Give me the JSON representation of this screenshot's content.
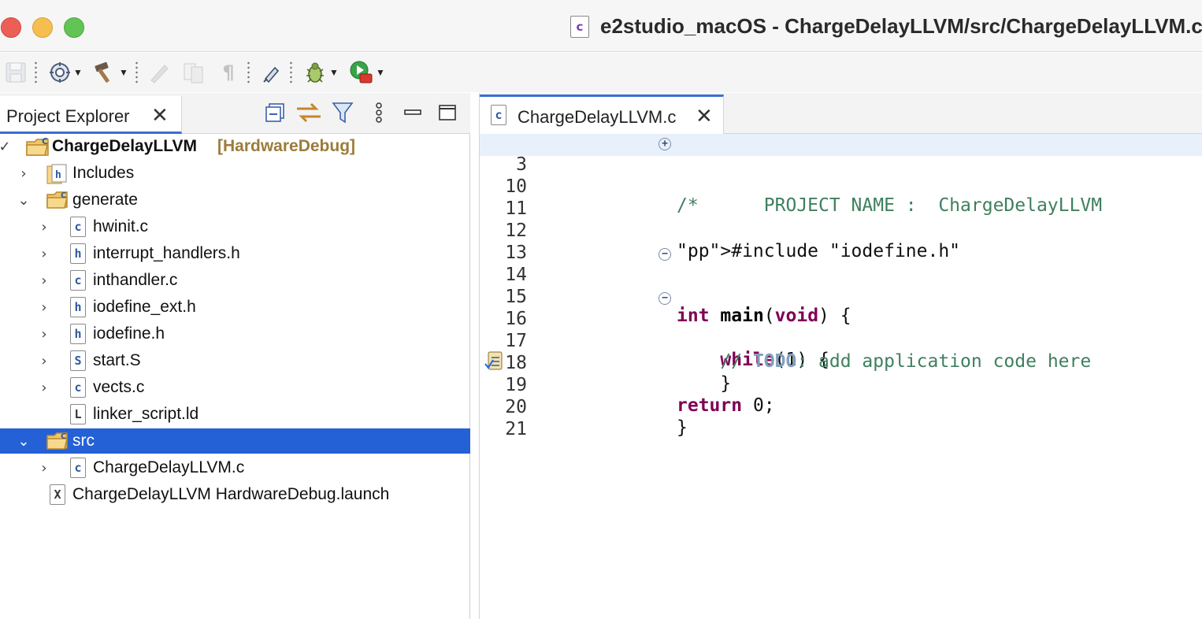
{
  "window": {
    "title": "e2studio_macOS - ChargeDelayLLVM/src/ChargeDelayLLVM.c",
    "doc_icon_letter": "c"
  },
  "toolbar": {
    "items": [
      {
        "name": "save",
        "icon": "floppy-disk-icon",
        "enabled": false
      },
      {
        "name": "build-config",
        "icon": "gear-clock-icon",
        "dropdown": true
      },
      {
        "name": "build",
        "icon": "hammer-icon",
        "dropdown": true
      },
      {
        "name": "edit",
        "icon": "pencil-icon",
        "enabled": false
      },
      {
        "name": "compare",
        "icon": "compare-icon",
        "enabled": false
      },
      {
        "name": "show-whitespace",
        "icon": "pilcrow-icon",
        "enabled": false
      },
      {
        "name": "toggle-mark",
        "icon": "marker-icon"
      },
      {
        "name": "debug",
        "icon": "bug-icon",
        "dropdown": true
      },
      {
        "name": "run-external",
        "icon": "run-tools-icon",
        "dropdown": true
      }
    ]
  },
  "project_explorer": {
    "tab_label": "Project Explorer",
    "tree": [
      {
        "label": "ChargeDelayLLVM",
        "decoration": "[HardwareDebug]",
        "icon": "project-folder-icon",
        "expanded": true,
        "indent": 0
      },
      {
        "label": "Includes",
        "icon": "includes-icon",
        "expanded": false,
        "indent": 1
      },
      {
        "label": "generate",
        "icon": "source-folder-icon",
        "expanded": true,
        "indent": 1
      },
      {
        "label": "hwinit.c",
        "icon": "c-file-icon",
        "letter": "c",
        "expanded": false,
        "indent": 2
      },
      {
        "label": "interrupt_handlers.h",
        "icon": "h-file-icon",
        "letter": "h",
        "expanded": false,
        "indent": 2
      },
      {
        "label": "inthandler.c",
        "icon": "c-file-icon",
        "letter": "c",
        "expanded": false,
        "indent": 2
      },
      {
        "label": "iodefine_ext.h",
        "icon": "h-file-icon",
        "letter": "h",
        "expanded": false,
        "indent": 2
      },
      {
        "label": "iodefine.h",
        "icon": "h-file-icon",
        "letter": "h",
        "expanded": false,
        "indent": 2
      },
      {
        "label": "start.S",
        "icon": "s-file-icon",
        "letter": "S",
        "expanded": false,
        "indent": 2
      },
      {
        "label": "vects.c",
        "icon": "c-file-icon",
        "letter": "c",
        "expanded": false,
        "indent": 2
      },
      {
        "label": "linker_script.ld",
        "icon": "ld-file-icon",
        "letter": "L",
        "indent": 2
      },
      {
        "label": "src",
        "icon": "source-folder-icon",
        "expanded": true,
        "selected": true,
        "indent": 1
      },
      {
        "label": "ChargeDelayLLVM.c",
        "icon": "c-file-icon",
        "letter": "c",
        "expanded": false,
        "indent": 2
      },
      {
        "label": "ChargeDelayLLVM HardwareDebug.launch",
        "icon": "launch-file-icon",
        "letter": "X",
        "indent": 1
      }
    ]
  },
  "editor": {
    "tab_label": "ChargeDelayLLVM.c",
    "lines": [
      {
        "num": "3",
        "text": "/*      PROJECT NAME :  ChargeDelayLLVM",
        "fold": "+",
        "highlight": true
      },
      {
        "num": "10",
        "text": ""
      },
      {
        "num": "11",
        "text": ""
      },
      {
        "num": "12",
        "text": "#include \"iodefine.h\""
      },
      {
        "num": "13",
        "text": ""
      },
      {
        "num": "14",
        "text": "int main(void) {",
        "fold": "−"
      },
      {
        "num": "15",
        "text": ""
      },
      {
        "num": "16",
        "text": "    while(1) {",
        "fold": "−"
      },
      {
        "num": "17",
        "text": "    // TODO: add application code here",
        "task_marker": true
      },
      {
        "num": "18",
        "text": "    }"
      },
      {
        "num": "19",
        "text": "return 0;"
      },
      {
        "num": "20",
        "text": "}"
      },
      {
        "num": "21",
        "text": ""
      }
    ]
  }
}
